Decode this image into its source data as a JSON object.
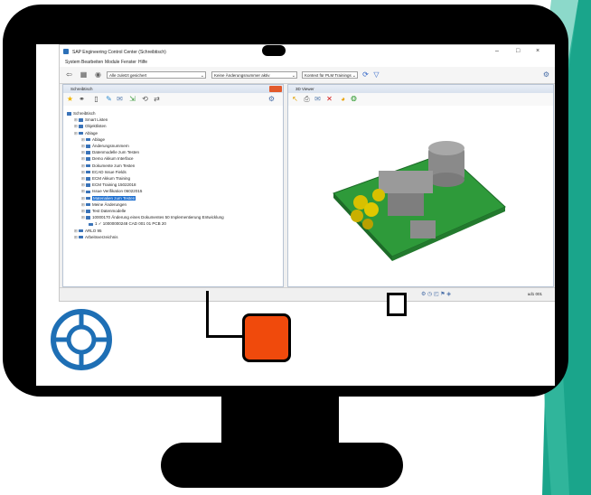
{
  "window": {
    "title": "SAP Engineering Control Center (Schreibtisch)",
    "controls": [
      "–",
      "□",
      "×"
    ]
  },
  "menu": [
    "System",
    "Bearbeiten",
    "Module",
    "Fenster",
    "Hilfe"
  ],
  "toolbar": {
    "combo1": "Alle zuletzt gesichert",
    "combo2": "Keine Änderungsnummer aktiv",
    "combo3": "Kontext für PLM Trainings"
  },
  "left_pane": {
    "title": "Schreibtisch",
    "tree": [
      {
        "indent": 0,
        "label": "Schreibtisch"
      },
      {
        "indent": 1,
        "label": "Smart Listen"
      },
      {
        "indent": 1,
        "label": "Objektlisten"
      },
      {
        "indent": 1,
        "label": "Ablage"
      },
      {
        "indent": 2,
        "label": "Ablage"
      },
      {
        "indent": 2,
        "label": "Änderungsnummern"
      },
      {
        "indent": 2,
        "label": "Datenmodelle zum Testen"
      },
      {
        "indent": 2,
        "label": "Demo Akkum Interface"
      },
      {
        "indent": 2,
        "label": "Dokumente zum Testen"
      },
      {
        "indent": 2,
        "label": "ECAD Issue Fields"
      },
      {
        "indent": 2,
        "label": "ECM Akkum Training"
      },
      {
        "indent": 2,
        "label": "ECM Training 15022018"
      },
      {
        "indent": 2,
        "label": "Issue Verifikation 06022015"
      },
      {
        "indent": 2,
        "label": "Materialien zum Testen",
        "selected": true
      },
      {
        "indent": 2,
        "label": "Meine Änderungen"
      },
      {
        "indent": 2,
        "label": "Test Datenmodelle"
      },
      {
        "indent": 2,
        "label": "10000170   Änderung eines Dokumentes        50   Implementierung Entwicklung"
      },
      {
        "indent": 3,
        "label": "1  ✓        10000000248   CAD   001   01   PCB                            20"
      },
      {
        "indent": 1,
        "label": "ARLO 95"
      },
      {
        "indent": 1,
        "label": "Arbeitsverzeichnis"
      }
    ]
  },
  "right_pane": {
    "title": "3D Viewer"
  },
  "status": {
    "system": "ud1 001"
  }
}
